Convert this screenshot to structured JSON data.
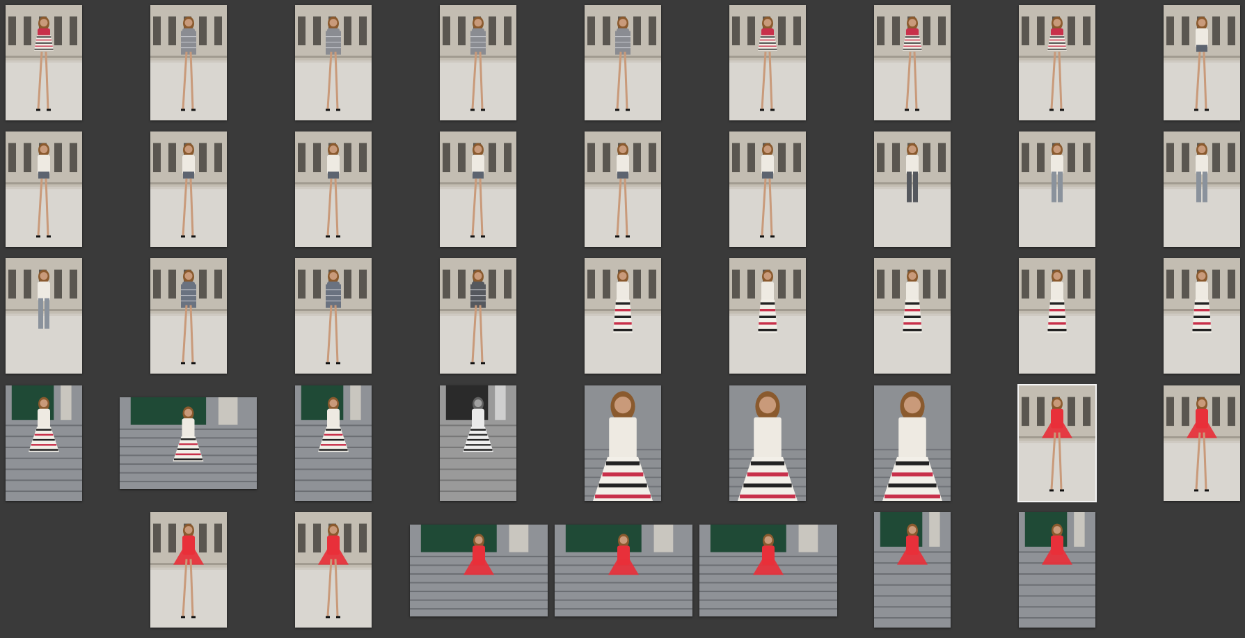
{
  "grid": {
    "background": "#3a3a3a",
    "photos": [
      {
        "scene": "building",
        "outfit": "stripe-dress",
        "color": "#c8304a",
        "selected": false
      },
      {
        "scene": "building",
        "outfit": "plaid-dress",
        "color": "#8a8c92",
        "selected": false
      },
      {
        "scene": "building",
        "outfit": "plaid-dress",
        "color": "#8a8c92",
        "selected": false
      },
      {
        "scene": "building",
        "outfit": "plaid-dress",
        "color": "#8a8c92",
        "selected": false
      },
      {
        "scene": "building",
        "outfit": "plaid-dress",
        "color": "#8a8c92",
        "selected": false
      },
      {
        "scene": "building",
        "outfit": "stripe-dress",
        "color": "#c8304a",
        "selected": false
      },
      {
        "scene": "building",
        "outfit": "stripe-dress",
        "color": "#c8304a",
        "selected": false
      },
      {
        "scene": "building",
        "outfit": "stripe-dress",
        "color": "#c8304a",
        "selected": false
      },
      {
        "scene": "building",
        "outfit": "shirt-shorts",
        "color": "#5d6470",
        "selected": false
      },
      {
        "scene": "building",
        "outfit": "shirt-shorts",
        "color": "#5d6470",
        "selected": false
      },
      {
        "scene": "building",
        "outfit": "shirt-shorts",
        "color": "#5d6470",
        "selected": false
      },
      {
        "scene": "building",
        "outfit": "shirt-shorts",
        "color": "#5d6470",
        "selected": false
      },
      {
        "scene": "building",
        "outfit": "shirt-shorts",
        "color": "#5d6470",
        "selected": false
      },
      {
        "scene": "building",
        "outfit": "shirt-shorts",
        "color": "#5d6470",
        "selected": false
      },
      {
        "scene": "building",
        "outfit": "shirt-shorts",
        "color": "#5d6470",
        "selected": false
      },
      {
        "scene": "building",
        "outfit": "shirt-pants",
        "color": "#55585e",
        "selected": false
      },
      {
        "scene": "building",
        "outfit": "shirt-pants",
        "color": "#8a929c",
        "selected": false
      },
      {
        "scene": "building",
        "outfit": "shirt-pants",
        "color": "#8a929c",
        "selected": false
      },
      {
        "scene": "building",
        "outfit": "shirt-pants",
        "color": "#8a929c",
        "selected": false
      },
      {
        "scene": "building",
        "outfit": "cape",
        "color": "#6a7280",
        "selected": false
      },
      {
        "scene": "building",
        "outfit": "cape",
        "color": "#6a7280",
        "selected": false
      },
      {
        "scene": "building",
        "outfit": "cape",
        "color": "#55585e",
        "selected": false
      },
      {
        "scene": "building",
        "outfit": "stripe-skirt",
        "color": "#c8304a",
        "selected": false
      },
      {
        "scene": "building",
        "outfit": "stripe-skirt",
        "color": "#c8304a",
        "selected": false
      },
      {
        "scene": "building",
        "outfit": "stripe-skirt",
        "color": "#c8304a",
        "selected": false
      },
      {
        "scene": "building",
        "outfit": "stripe-skirt",
        "color": "#c8304a",
        "selected": false
      },
      {
        "scene": "building",
        "outfit": "stripe-skirt",
        "color": "#c8304a",
        "selected": false
      },
      {
        "scene": "steps-door",
        "outfit": "stripe-gown",
        "color": "#c8304a",
        "selected": false
      },
      {
        "scene": "steps-door",
        "outfit": "stripe-gown",
        "color": "#c8304a",
        "selected": false
      },
      {
        "scene": "steps-door",
        "outfit": "stripe-gown",
        "color": "#c8304a",
        "selected": false
      },
      {
        "scene": "steps-door-bw",
        "outfit": "stripe-gown",
        "color": "#333333",
        "selected": false
      },
      {
        "scene": "closeup",
        "outfit": "stripe-gown",
        "color": "#c8304a",
        "selected": false
      },
      {
        "scene": "closeup",
        "outfit": "stripe-gown",
        "color": "#c8304a",
        "selected": false
      },
      {
        "scene": "closeup",
        "outfit": "stripe-gown",
        "color": "#c8304a",
        "selected": false
      },
      {
        "scene": "building",
        "outfit": "red-dress",
        "color": "#e8303a",
        "selected": true
      },
      {
        "scene": "building",
        "outfit": "red-dress",
        "color": "#e8303a",
        "selected": false
      },
      {
        "scene": "building",
        "outfit": "red-dress",
        "color": "#e8303a",
        "selected": false
      },
      {
        "scene": "building",
        "outfit": "red-dress",
        "color": "#e8303a",
        "selected": false
      },
      {
        "scene": "steps-door",
        "outfit": "red-dress",
        "color": "#e8303a",
        "selected": false
      },
      {
        "scene": "steps-door",
        "outfit": "red-dress",
        "color": "#e8303a",
        "selected": false
      },
      {
        "scene": "steps-door",
        "outfit": "red-dress",
        "color": "#e8303a",
        "selected": false
      },
      {
        "scene": "steps-door",
        "outfit": "red-dress",
        "color": "#e8303a",
        "selected": false
      },
      {
        "scene": "steps-door",
        "outfit": "red-dress",
        "color": "#e8303a",
        "selected": false
      }
    ]
  }
}
